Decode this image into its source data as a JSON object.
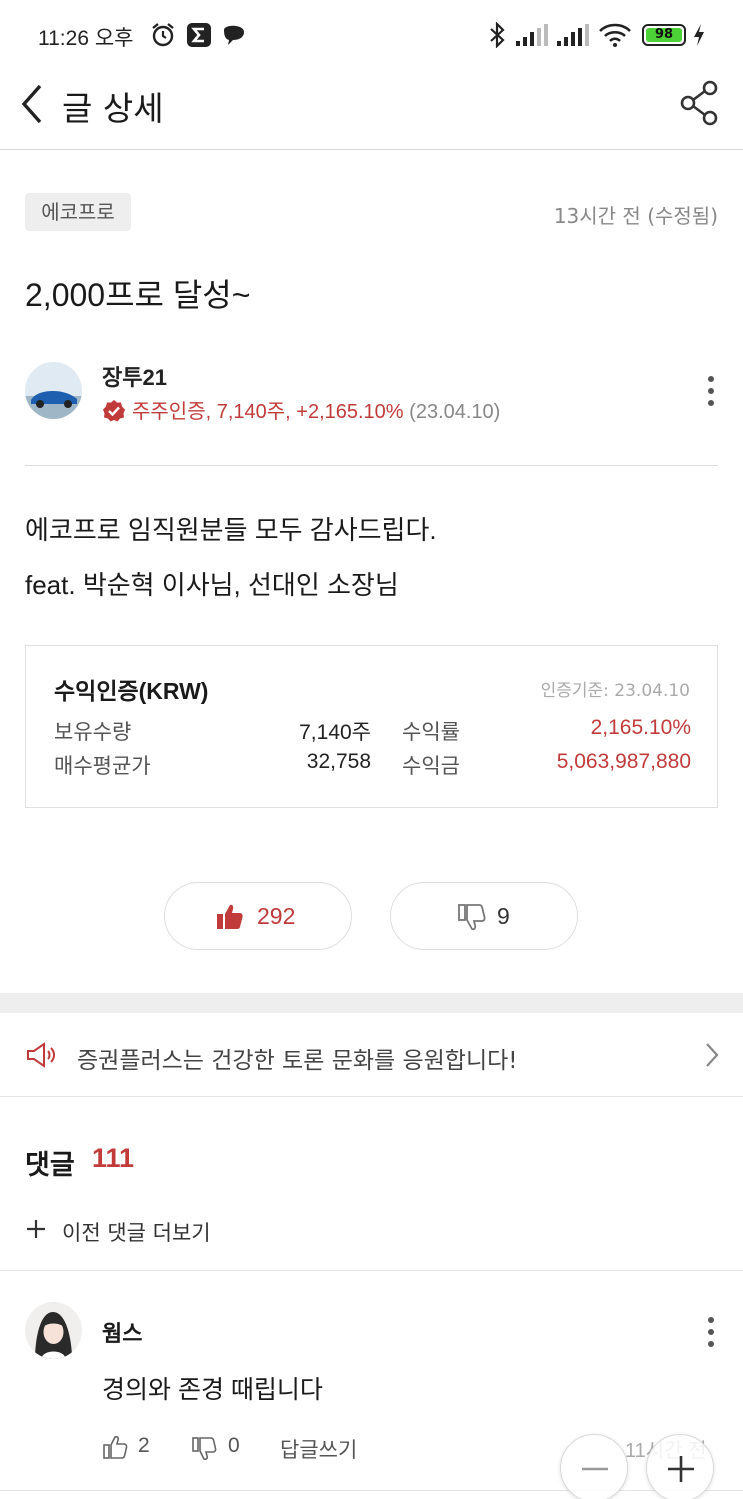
{
  "status_bar": {
    "time": "11:26 오후",
    "battery": "98"
  },
  "nav": {
    "title": "글 상세"
  },
  "post": {
    "tag": "에코프로",
    "time": "13시간 전 (수정됨)",
    "title": "2,000프로 달성~",
    "author": "장투21",
    "cert_text": "주주인증, 7,140주, +2,165.10%",
    "cert_date": "(23.04.10)",
    "body_lines": [
      "에코프로 임직원분들 모두 감사드립다.",
      "feat. 박순혁 이사님, 선대인 소장님"
    ]
  },
  "proof": {
    "title": "수익인증(KRW)",
    "date": "인증기준: 23.04.10",
    "rows": [
      {
        "label1": "보유수량",
        "value1": "7,140주",
        "label2": "수익률",
        "value2": "2,165.10%"
      },
      {
        "label1": "매수평균가",
        "value1": "32,758",
        "label2": "수익금",
        "value2": "5,063,987,880"
      }
    ]
  },
  "votes": {
    "likes": "292",
    "dislikes": "9"
  },
  "notice": {
    "text": "증권플러스는 건강한 토론 문화를 응원합니다!"
  },
  "comments": {
    "title": "댓글",
    "count": "111",
    "load_prev": "이전 댓글 더보기",
    "items": [
      {
        "author": "웜스",
        "body": "경의와 존경 때립니다",
        "likes": "2",
        "dislikes": "0",
        "reply": "답글쓰기",
        "time": "11시간 전"
      }
    ]
  },
  "colors": {
    "accent_red": "#c23b3b",
    "battery_green": "#4cd137"
  },
  "icons": {
    "back": "chevron-left-icon",
    "share": "share-icon",
    "more": "more-vertical-icon",
    "cert": "verified-badge-icon",
    "like": "thumbs-up-icon",
    "dislike": "thumbs-down-icon",
    "notice": "megaphone-icon",
    "zoom_out": "minus-icon",
    "zoom_in": "plus-icon"
  }
}
